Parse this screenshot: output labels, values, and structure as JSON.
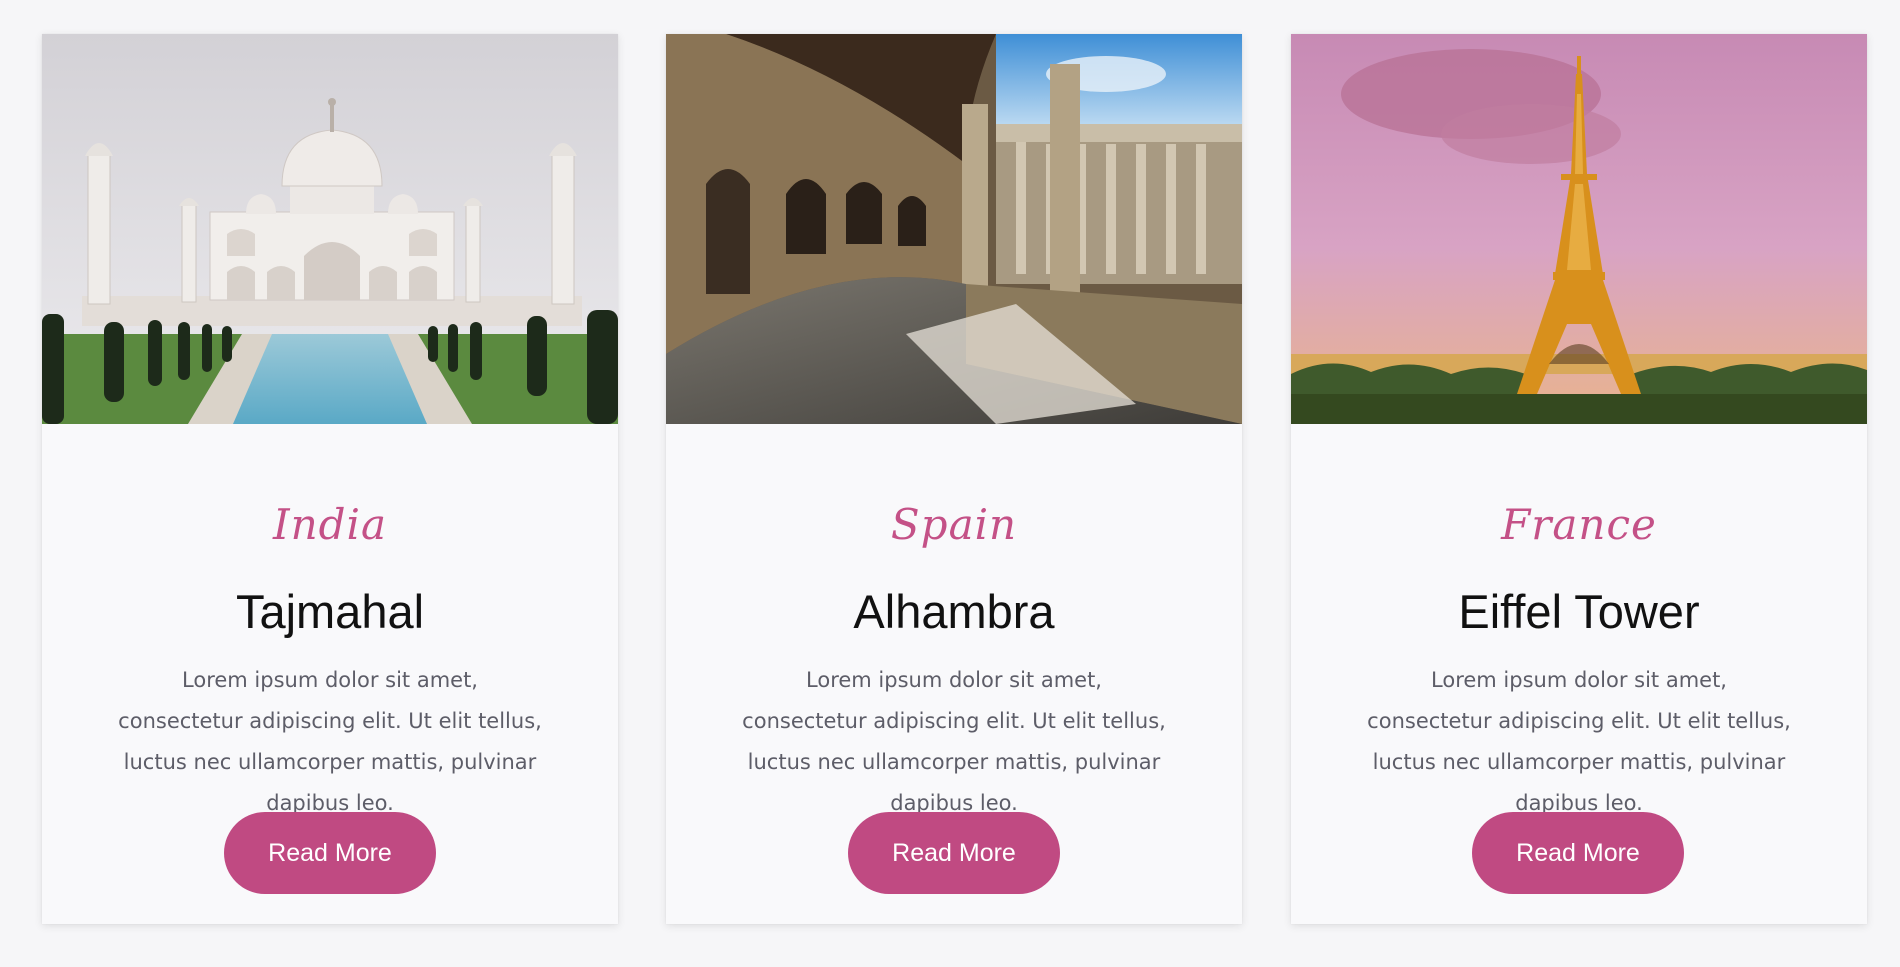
{
  "cards": [
    {
      "country": "India",
      "title": "Tajmahal",
      "description": "Lorem ipsum dolor sit amet, consectetur adipiscing elit. Ut elit tellus, luctus nec ullamcorper mattis, pulvinar dapibus leo.",
      "button_label": "Read More",
      "image_icon": "tajmahal-photo"
    },
    {
      "country": "Spain",
      "title": "Alhambra",
      "description": "Lorem ipsum dolor sit amet, consectetur adipiscing elit. Ut elit tellus, luctus nec ullamcorper mattis, pulvinar dapibus leo.",
      "button_label": "Read More",
      "image_icon": "alhambra-photo"
    },
    {
      "country": "France",
      "title": "Eiffel Tower",
      "description": "Lorem ipsum dolor sit amet, consectetur adipiscing elit. Ut elit tellus, luctus nec ullamcorper mattis, pulvinar dapibus leo.",
      "button_label": "Read More",
      "image_icon": "eiffel-tower-photo"
    }
  ],
  "colors": {
    "accent": "#c04a82",
    "country_text": "#c45187",
    "title_text": "#111111",
    "body_text": "#5d5d68",
    "page_background": "#f6f6f8",
    "card_background": "#f9f9fb"
  }
}
